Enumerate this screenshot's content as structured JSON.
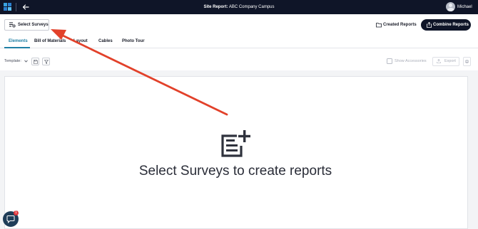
{
  "header": {
    "title_label": "Site Report:",
    "title_value": "ABC Company Campus",
    "username": "Michael"
  },
  "actions": {
    "select_surveys": "Select Surveys",
    "created_reports": "Created Reports",
    "combine_reports": "Combine Reports"
  },
  "tabs": [
    {
      "label": "Elements",
      "active": true
    },
    {
      "label": "Bill of Materials",
      "active": false
    },
    {
      "label": "Layout",
      "active": false
    },
    {
      "label": "Cables",
      "active": false
    },
    {
      "label": "Photo Tour",
      "active": false
    }
  ],
  "toolbar": {
    "template_label": "Template:",
    "show_accessories": "Show Accessories",
    "export": "Export"
  },
  "empty_state": {
    "message": "Select Surveys to create reports",
    "icon": "add-report-icon"
  },
  "chat": {
    "badge_count": "1"
  },
  "colors": {
    "topbar": "#0f1528",
    "accent": "#1f7fa5",
    "annotation_arrow": "#e2412a"
  }
}
